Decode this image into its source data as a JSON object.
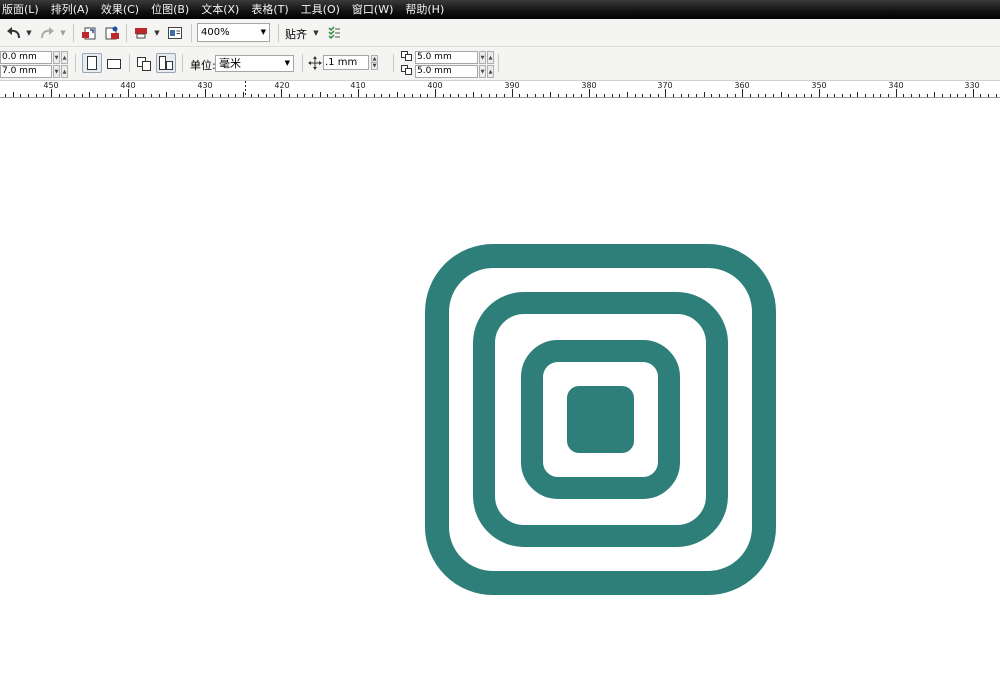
{
  "menu": [
    {
      "label": "版面(L)",
      "name": "menu-layout"
    },
    {
      "label": "排列(A)",
      "name": "menu-arrange"
    },
    {
      "label": "效果(C)",
      "name": "menu-effects"
    },
    {
      "label": "位图(B)",
      "name": "menu-bitmaps"
    },
    {
      "label": "文本(X)",
      "name": "menu-text"
    },
    {
      "label": "表格(T)",
      "name": "menu-table"
    },
    {
      "label": "工具(O)",
      "name": "menu-tools"
    },
    {
      "label": "窗口(W)",
      "name": "menu-window"
    },
    {
      "label": "帮助(H)",
      "name": "menu-help"
    }
  ],
  "toolbar": {
    "zoom_value": "400%",
    "snap_label": "贴齐"
  },
  "propbar": {
    "width_value": "0.0 mm",
    "height_value": "7.0 mm",
    "unit_label": "单位:",
    "unit_value": "毫米",
    "nudge_value": ".1 mm",
    "dup_x_value": "5.0 mm",
    "dup_y_value": "5.0 mm"
  },
  "ruler": {
    "labels": [
      "450",
      "440",
      "430",
      "420",
      "410",
      "400",
      "390",
      "380",
      "370",
      "360",
      "350",
      "340",
      "330"
    ]
  },
  "colors": {
    "accent": "#2e7f7a",
    "menubar": "#111111",
    "toolbar": "#f4f4f2"
  },
  "icons": [
    "undo-icon",
    "redo-icon",
    "import-icon",
    "export-icon",
    "publish-icon",
    "app-launcher-icon",
    "snap-options-icon",
    "portrait-icon",
    "landscape-icon",
    "all-pages-icon",
    "current-page-icon",
    "nudge-icon",
    "duplicate-x-icon",
    "duplicate-y-icon"
  ]
}
